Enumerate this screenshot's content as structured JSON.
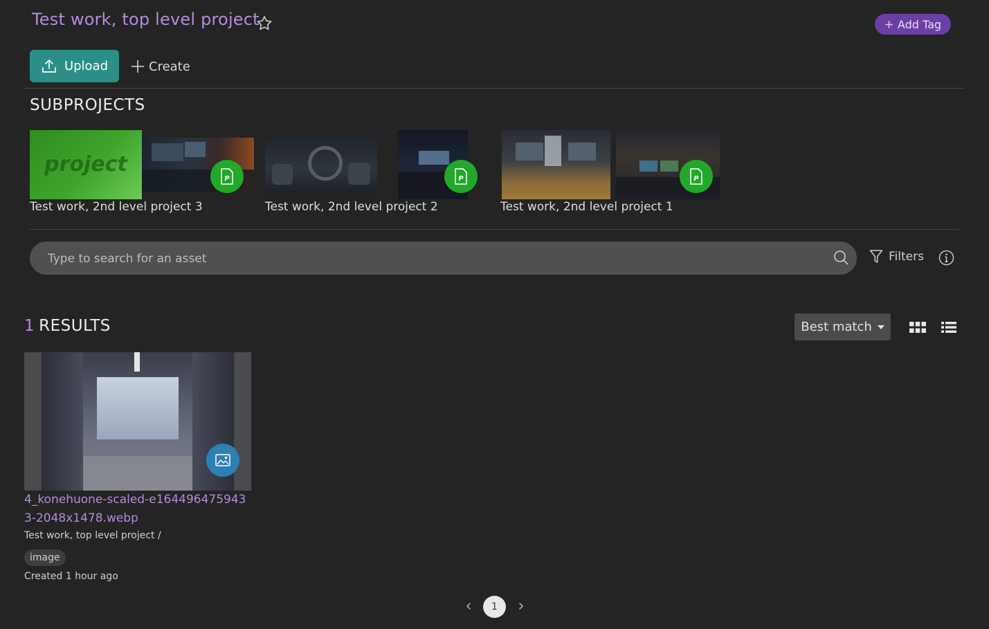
{
  "header": {
    "title": "Test work, top level project",
    "add_tag_label": "Add Tag"
  },
  "toolbar": {
    "upload_label": "Upload",
    "create_label": "Create"
  },
  "subprojects": {
    "heading": "SUBPROJECTS",
    "placeholder_text": "project",
    "items": [
      {
        "label": "Test work, 2nd level project 3"
      },
      {
        "label": "Test work, 2nd level project 2"
      },
      {
        "label": "Test work, 2nd level project 1"
      }
    ]
  },
  "search": {
    "placeholder": "Type to search for an asset",
    "filters_label": "Filters"
  },
  "results": {
    "count": "1",
    "label": "RESULTS",
    "sort_label": "Best match"
  },
  "assets": [
    {
      "name": "4_konehuone-scaled-e1644964759433-2048x1478.webp",
      "path": "Test work, top level project /",
      "tag": "image",
      "created": "Created 1 hour ago"
    }
  ],
  "pagination": {
    "current": "1"
  },
  "colors": {
    "accent": "#b38be0",
    "upload_bg": "#2b8f87",
    "tag_button_bg": "#6c3fa5",
    "project_badge": "#22a82a",
    "image_badge": "#2e7fb2",
    "background": "#242424"
  }
}
